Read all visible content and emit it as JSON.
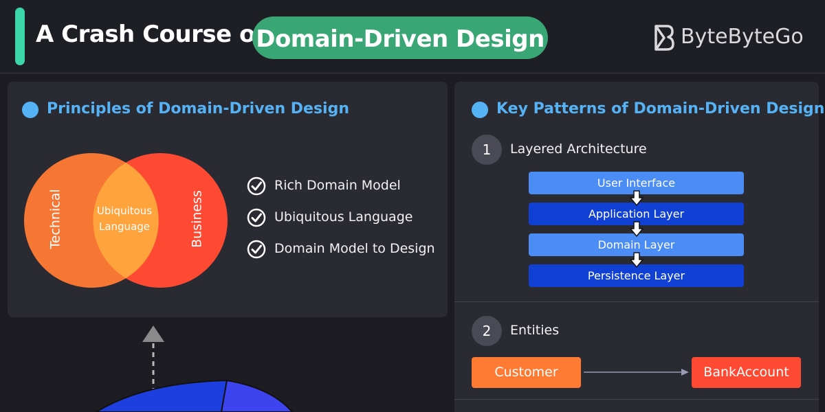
{
  "header": {
    "title_prefix": "A Crash Course on",
    "title_highlight": "Domain-Driven Design",
    "brand": "ByteByteGo"
  },
  "principles": {
    "title": "Principles of Domain-Driven Design",
    "venn": {
      "left_label": "Technical",
      "right_label": "Business",
      "center_line1": "Ubiquitous",
      "center_line2": "Language"
    },
    "items": [
      "Rich Domain Model",
      "Ubiquitous Language",
      "Domain Model to Design"
    ]
  },
  "patterns": {
    "title": "Key Patterns of Domain-Driven Design",
    "sections": [
      {
        "number": "1",
        "label": "Layered Architecture",
        "layers": [
          "User Interface",
          "Application Layer",
          "Domain Layer",
          "Persistence Layer"
        ]
      },
      {
        "number": "2",
        "label": "Entities",
        "entities": [
          "Customer",
          "BankAccount"
        ]
      }
    ]
  },
  "colors": {
    "accent_green": "#3dd6a8",
    "pill_green": "#3aa675",
    "heading_blue": "#55b3f5",
    "layer_light": "#4b8df5",
    "layer_dark": "#1040d4",
    "entity_orange": "#ff7a33",
    "entity_red": "#ff4a33"
  }
}
